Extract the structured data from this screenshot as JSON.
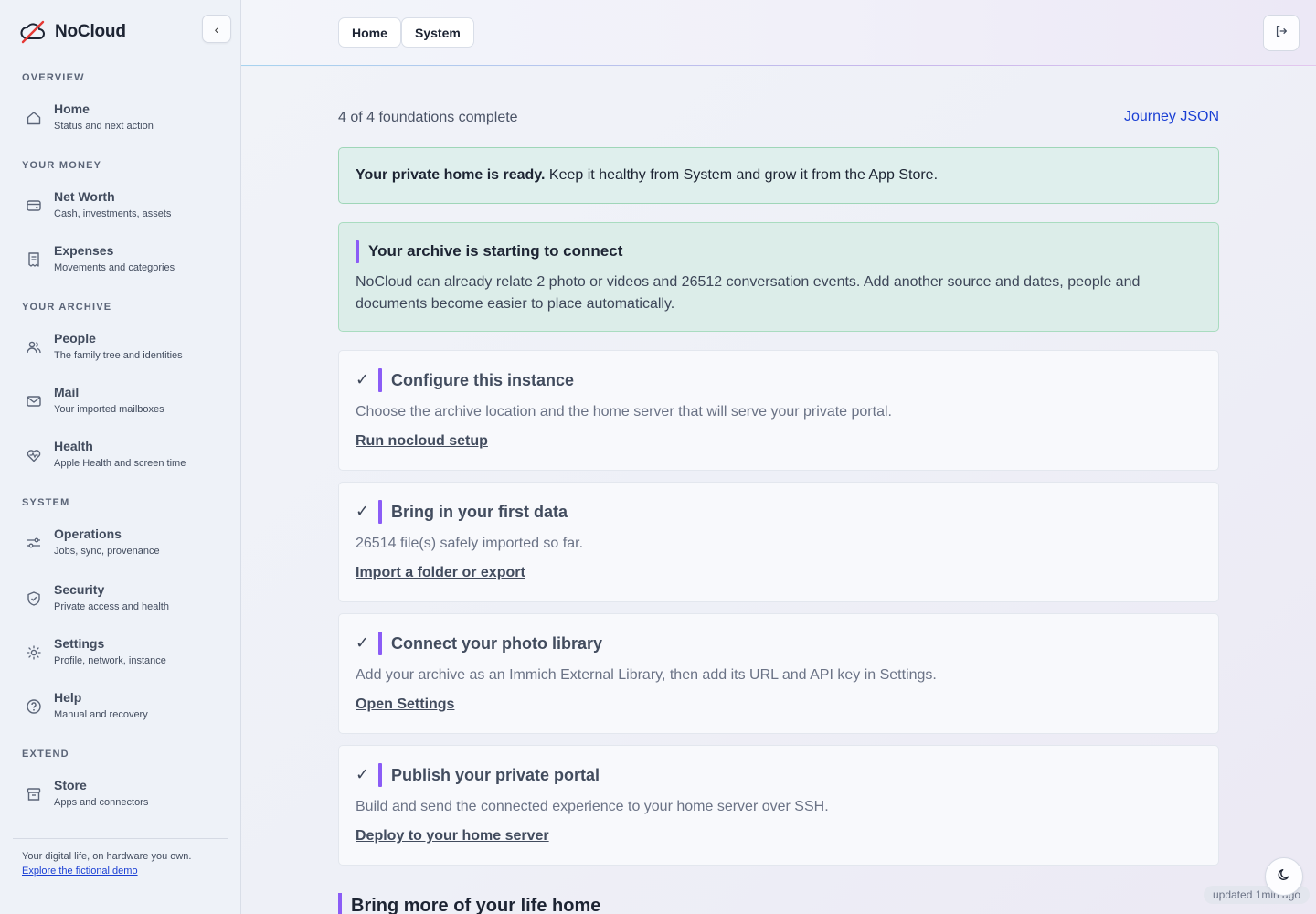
{
  "app": {
    "name": "NoCloud"
  },
  "sidebar": {
    "collapse_glyph": "‹",
    "sections": [
      {
        "label": "OVERVIEW"
      },
      {
        "label": "YOUR MONEY"
      },
      {
        "label": "YOUR ARCHIVE"
      },
      {
        "label": "SYSTEM"
      },
      {
        "label": "EXTEND"
      }
    ],
    "items": [
      {
        "title": "Home",
        "subtitle": "Status and next action",
        "icon": "home-icon"
      },
      {
        "title": "Net Worth",
        "subtitle": "Cash, investments, assets",
        "icon": "wallet-icon"
      },
      {
        "title": "Expenses",
        "subtitle": "Movements and categories",
        "icon": "receipt-icon"
      },
      {
        "title": "People",
        "subtitle": "The family tree and identities",
        "icon": "people-icon"
      },
      {
        "title": "Mail",
        "subtitle": "Your imported mailboxes",
        "icon": "mail-icon"
      },
      {
        "title": "Health",
        "subtitle": "Apple Health and screen time",
        "icon": "heart-pulse-icon"
      },
      {
        "title": "Operations",
        "subtitle": "Jobs, sync, provenance",
        "icon": "sliders-icon"
      },
      {
        "title": "Security",
        "subtitle": "Private access and health",
        "icon": "shield-check-icon"
      },
      {
        "title": "Settings",
        "subtitle": "Profile, network, instance",
        "icon": "sun-gear-icon"
      },
      {
        "title": "Help",
        "subtitle": "Manual and recovery",
        "icon": "help-circle-icon"
      },
      {
        "title": "Store",
        "subtitle": "Apps and connectors",
        "icon": "store-box-icon"
      }
    ],
    "footer": {
      "tagline": "Your digital life, on hardware you own.",
      "demo_link": "Explore the fictional demo"
    }
  },
  "topbar": {
    "tabs": [
      {
        "label": "Home"
      },
      {
        "label": "System"
      }
    ]
  },
  "main": {
    "progress": "4 of 4 foundations complete",
    "journey_link": "Journey JSON",
    "ready_banner": {
      "bold": "Your private home is ready.",
      "text": " Keep it healthy from System and grow it from the App Store."
    },
    "archive": {
      "title": "Your archive is starting to connect",
      "body": "NoCloud can already relate 2 photo or videos and 26512 conversation events. Add another source and dates, people and documents become easier to place automatically."
    },
    "steps": [
      {
        "check": "✓",
        "title": "Configure this instance",
        "description": "Choose the archive location and the home server that will serve your private portal.",
        "action": "Run nocloud setup"
      },
      {
        "check": "✓",
        "title": "Bring in your first data",
        "description": "26514 file(s) safely imported so far.",
        "action": "Import a folder or export"
      },
      {
        "check": "✓",
        "title": "Connect your photo library",
        "description": "Add your archive as an Immich External Library, then add its URL and API key in Settings.",
        "action": "Open Settings"
      },
      {
        "check": "✓",
        "title": "Publish your private portal",
        "description": "Build and send the connected experience to your home server over SSH.",
        "action": "Deploy to your home server"
      }
    ],
    "more_heading": "Bring more of your life home"
  },
  "status": {
    "updated": "updated 1min ago"
  },
  "colors": {
    "accent": "#8b5cf6",
    "link": "#1a3fd4",
    "success_border": "#9fd6b8"
  }
}
